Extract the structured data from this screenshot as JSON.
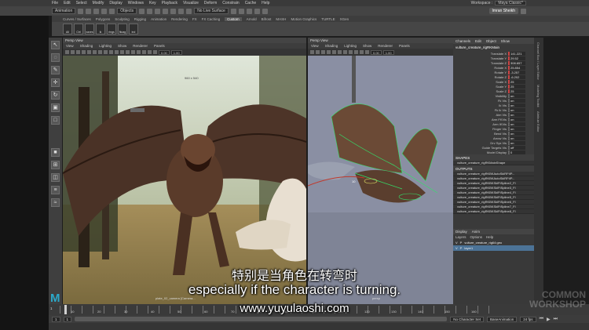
{
  "menubar": {
    "items": [
      "File",
      "Edit",
      "Select",
      "Modify",
      "Display",
      "Windows",
      "Key",
      "Playback",
      "Visualize",
      "Deform",
      "Constrain",
      "Cache",
      "Help"
    ],
    "workspace_label": "Workspace :",
    "workspace_value": "Maya Classic*"
  },
  "statusline": {
    "menuset": "Animation",
    "objects_label": "Objects",
    "live_surface": "No Live Surface",
    "user": "Imran Sheikh"
  },
  "shelf": {
    "tabs": [
      "Curves / Surfaces",
      "Polygons",
      "Sculpting",
      "Rigging",
      "Animation",
      "Rendering",
      "FX",
      "FX Caching",
      "Custom",
      "Arnold",
      "Bifrost",
      "MASH",
      "Motion Graphics",
      "TURTLE",
      "XGen"
    ],
    "active_tab": "Custom",
    "buttons": [
      "All",
      "Ctrl",
      "xaxes",
      "ik",
      "rings",
      "fkcag",
      "ind"
    ]
  },
  "left_viewport": {
    "title": "Persp View",
    "menus": [
      "View",
      "Shading",
      "Lighting",
      "Show",
      "Renderer",
      "Panels"
    ],
    "field_a": "0.00",
    "field_b": "1.00",
    "resolution": "960 x 540",
    "camera_label": "plate_02_camera [Camera..."
  },
  "right_viewport": {
    "title": "Persp View",
    "menus": [
      "View",
      "Shading",
      "Lighting",
      "Show",
      "Renderer",
      "Panels"
    ],
    "field_a": "0.00",
    "field_b": "1.00",
    "camera_label": "persp",
    "axis_label": "10"
  },
  "channelbox": {
    "tabs": [
      "Channels",
      "Edit",
      "Object",
      "Show"
    ],
    "node": "vulture_creature_rigRKMain",
    "attributes": [
      {
        "name": "Translate X",
        "value": "141.221"
      },
      {
        "name": "Translate Y",
        "value": "29.52"
      },
      {
        "name": "Translate Z",
        "value": "308.657"
      },
      {
        "name": "Rotate X",
        "value": "25.854"
      },
      {
        "name": "Rotate Y",
        "value": "-3.257"
      },
      {
        "name": "Rotate Z",
        "value": "-6.202"
      },
      {
        "name": "Scale X",
        "value": "25"
      },
      {
        "name": "Scale Y",
        "value": "25"
      },
      {
        "name": "Scale Z",
        "value": "25"
      },
      {
        "name": "Visibility",
        "value": "on"
      },
      {
        "name": "Fk Vis",
        "value": "on"
      },
      {
        "name": "Ik Vis",
        "value": "on"
      },
      {
        "name": "Fk Ik Vis",
        "value": "on"
      },
      {
        "name": "Aim Vis",
        "value": "on"
      },
      {
        "name": "Arm FKVis",
        "value": "on"
      },
      {
        "name": "Arm IKVis",
        "value": "on"
      },
      {
        "name": "Finger Vis",
        "value": "on"
      },
      {
        "name": "Bend Vis",
        "value": "on"
      },
      {
        "name": "Arrow Vis",
        "value": "on"
      },
      {
        "name": "Drv Sys Vis",
        "value": "on"
      },
      {
        "name": "Guide Targets Vis",
        "value": "off"
      },
      {
        "name": "Model Display",
        "value": "0"
      }
    ],
    "shapes_header": "SHAPES",
    "shape_node": "vulture_creature_rigRKMainShape",
    "outputs_header": "OUTPUTS",
    "outputs": [
      "vulture_creature_rigRKBKAutoSklRFtIP...",
      "vulture_creature_rigRKBKAutoSklRFtIP...",
      "vulture_creature_rigRKBKSklFtSpline2_Fl",
      "vulture_creature_rigRKBKSklFtSpline3_Fl",
      "vulture_creature_rigRKBKSklFtSpline4_Fl",
      "vulture_creature_rigRKBKSklFtSpline5_Fl",
      "vulture_creature_rigRKBKSklFtSpline6_Fl",
      "vulture_creature_rigRKBKSklFtSpline7_Fl",
      "vulture_creature_rigRKBKSklFtSpline8_Fl"
    ]
  },
  "layer_editor": {
    "tabs": [
      "Display",
      "Anim"
    ],
    "menus": [
      "Layers",
      "Options",
      "Help"
    ],
    "rows": [
      {
        "label": "vulture_creature_rig64:geo",
        "selected": false
      },
      {
        "label": "layer1",
        "selected": true
      }
    ]
  },
  "right_tabs": [
    "Channel Box / Layer Editor",
    "Modeling Toolkit",
    "Attribute Editor"
  ],
  "timeline": {
    "current_frame": "1",
    "start_frame": "1",
    "tick_labels": [
      "10",
      "20",
      "30",
      "40",
      "50",
      "60",
      "70",
      "80",
      "90",
      "100",
      "110",
      "120",
      "130",
      "140",
      "150",
      "160"
    ],
    "character_set": "No Character Set",
    "anim_layer": "BaseAnimation",
    "fps": "24 fps"
  },
  "subtitles": {
    "chinese": "特别是当角色在转弯时",
    "english": "especially if the character is turning.",
    "url": "www.yuyulaoshi.com"
  },
  "watermark": [
    "COMMON",
    "WORKSHOP"
  ]
}
